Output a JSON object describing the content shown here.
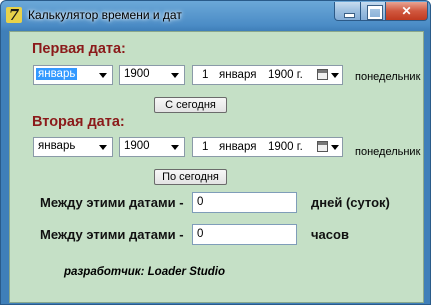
{
  "window": {
    "title": "Калькулятор времени и дат",
    "icon": "app-icon",
    "icon_glyph": "7"
  },
  "first_date": {
    "heading": "Первая дата:",
    "month": "январь",
    "year": "1900",
    "date_day": "1",
    "date_month": "января",
    "date_year": "1900 г.",
    "weekday": "понедельник",
    "button": "С сегодня"
  },
  "second_date": {
    "heading": "Вторая дата:",
    "month": "январь",
    "year": "1900",
    "date_day": "1",
    "date_month": "января",
    "date_year": "1900 г.",
    "weekday": "понедельник",
    "button": "По сегодня"
  },
  "results": {
    "days_label": "Между этими датами -",
    "days_value": "0",
    "days_unit": "дней (суток)",
    "hours_label": "Между этими датами -",
    "hours_value": "0",
    "hours_unit": "часов"
  },
  "footer": {
    "credit": "разработчик: Loader Studio"
  }
}
